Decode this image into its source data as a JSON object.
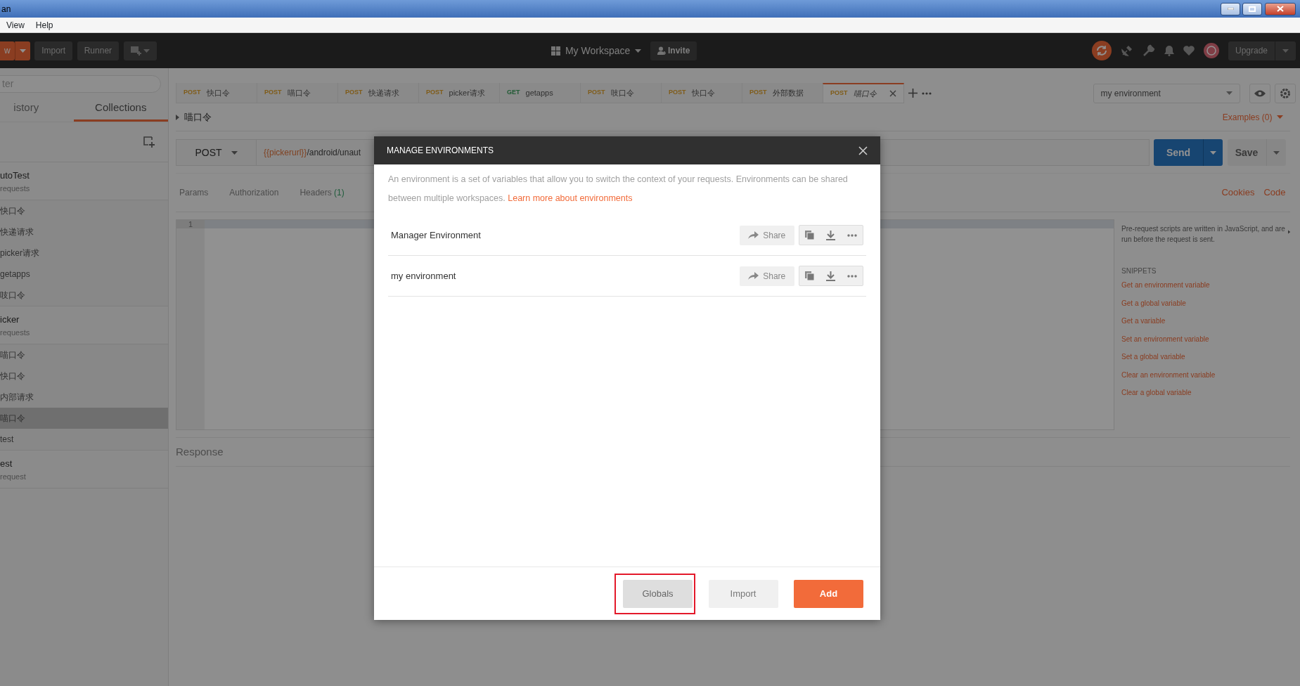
{
  "window": {
    "title": "an"
  },
  "menu": [
    {
      "label": "View"
    },
    {
      "label": "Help"
    }
  ],
  "header": {
    "new_label": "w",
    "import_label": "Import",
    "runner_label": "Runner",
    "workspace": "My Workspace",
    "invite": "Invite",
    "upgrade": "Upgrade"
  },
  "sidebar": {
    "filter_placeholder": "ter",
    "tabs": [
      {
        "label": "istory",
        "selected": false
      },
      {
        "label": "Collections",
        "selected": true
      }
    ],
    "collections": [
      {
        "name": "utoTest",
        "meta": "requests",
        "requests": [
          {
            "name": "快口令",
            "selected": false
          },
          {
            "name": "快递请求",
            "selected": false
          },
          {
            "name": "picker请求",
            "selected": false
          },
          {
            "name": "getapps",
            "selected": false
          },
          {
            "name": "吱口令",
            "selected": false
          }
        ]
      },
      {
        "name": "icker",
        "meta": "requests",
        "requests": [
          {
            "name": "喵口令",
            "selected": false
          },
          {
            "name": "快口令",
            "selected": false
          },
          {
            "name": "内部请求",
            "selected": false
          },
          {
            "name": "喵口令",
            "selected": true
          },
          {
            "name": "test",
            "selected": false
          }
        ]
      },
      {
        "name": "est",
        "meta": "request"
      }
    ]
  },
  "tabs": [
    {
      "method": "POST",
      "kind": "post",
      "name": "快口令",
      "selected": false
    },
    {
      "method": "POST",
      "kind": "post",
      "name": "喵口令",
      "selected": false
    },
    {
      "method": "POST",
      "kind": "post",
      "name": "快递请求",
      "selected": false
    },
    {
      "method": "POST",
      "kind": "post",
      "name": "picker请求",
      "selected": false
    },
    {
      "method": "GET",
      "kind": "get",
      "name": "getapps",
      "selected": false
    },
    {
      "method": "POST",
      "kind": "post",
      "name": "吱口令",
      "selected": false
    },
    {
      "method": "POST",
      "kind": "post",
      "name": "快口令",
      "selected": false
    },
    {
      "method": "POST",
      "kind": "post",
      "name": "外部数据",
      "selected": false
    },
    {
      "method": "POST",
      "kind": "post",
      "name": "喵口令",
      "selected": true
    }
  ],
  "environment": {
    "value": "my environment"
  },
  "request": {
    "breadcrumb": "喵口令",
    "examples": "Examples (0)",
    "method": "POST",
    "url_variable": "{{pickerurl}}",
    "url_path": "/android/unaut",
    "send": "Send",
    "save": "Save",
    "tabs": [
      {
        "label": "Params"
      },
      {
        "label": "Authorization"
      },
      {
        "label": "Headers",
        "count": "(1)"
      }
    ],
    "links": [
      {
        "label": "Cookies"
      },
      {
        "label": "Code"
      }
    ],
    "line_numbers": [
      "1"
    ]
  },
  "scripts": {
    "help": "Pre-request scripts are written in JavaScript, and are run before the request is sent.",
    "snippets_title": "SNIPPETS",
    "snippets": [
      "Get an environment variable",
      "Get a global variable",
      "Get a variable",
      "Set an environment variable",
      "Set a global variable",
      "Clear an environment variable",
      "Clear a global variable"
    ]
  },
  "response": {
    "title": "Response"
  },
  "modal": {
    "title": "MANAGE ENVIRONMENTS",
    "description": "An environment is a set of variables that allow you to switch the context of your requests. Environments can be shared between multiple workspaces.",
    "link": "Learn more about environments",
    "environments": [
      {
        "name": "Manager Environment",
        "share": "Share"
      },
      {
        "name": "my environment",
        "share": "Share"
      }
    ],
    "buttons": [
      {
        "label": "Globals",
        "kind": "secondary",
        "highlighted": true
      },
      {
        "label": "Import",
        "kind": "light",
        "highlighted": false
      },
      {
        "label": "Add",
        "kind": "primary",
        "highlighted": false
      }
    ]
  }
}
